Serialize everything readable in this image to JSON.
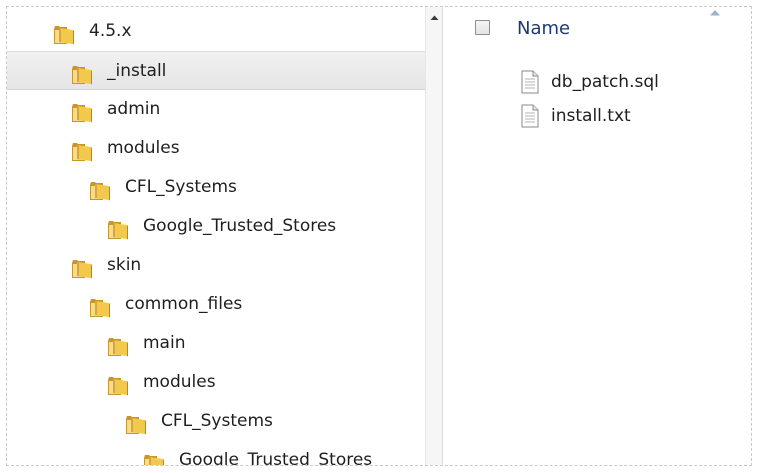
{
  "folder_tree": {
    "items": [
      {
        "label": "4.5.x",
        "depth": 2,
        "selected": false
      },
      {
        "label": "_install",
        "depth": 3,
        "selected": true
      },
      {
        "label": "admin",
        "depth": 3,
        "selected": false
      },
      {
        "label": "modules",
        "depth": 3,
        "selected": false
      },
      {
        "label": "CFL_Systems",
        "depth": 4,
        "selected": false
      },
      {
        "label": "Google_Trusted_Stores",
        "depth": 5,
        "selected": false
      },
      {
        "label": "skin",
        "depth": 3,
        "selected": false
      },
      {
        "label": "common_files",
        "depth": 4,
        "selected": false
      },
      {
        "label": "main",
        "depth": 5,
        "selected": false
      },
      {
        "label": "modules",
        "depth": 5,
        "selected": false
      },
      {
        "label": "CFL_Systems",
        "depth": 6,
        "selected": false
      },
      {
        "label": "Google_Trusted_Stores",
        "depth": 7,
        "selected": false
      }
    ]
  },
  "file_list": {
    "column_name": "Name",
    "sort": "ascending",
    "files": [
      {
        "name": "db_patch.sql",
        "icon": "text-file-icon"
      },
      {
        "name": "install.txt",
        "icon": "text-file-icon"
      }
    ]
  },
  "icons": {
    "folder": "folder-icon",
    "file": "text-file-icon",
    "scroll_up": "scroll-up-arrow-icon",
    "sort": "sort-ascending-icon"
  },
  "colors": {
    "folder_body": "#f2c94c",
    "folder_dark": "#c9962b",
    "selection": "#e8e8e8",
    "header_text": "#1e3a6e"
  }
}
